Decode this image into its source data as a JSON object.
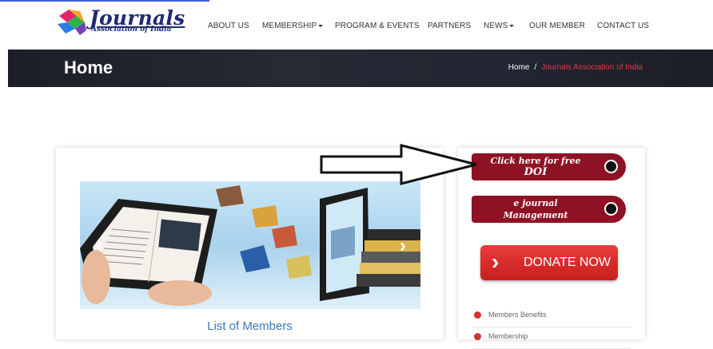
{
  "header": {
    "brand": "Journals",
    "brand_sub": "Association of India",
    "nav": [
      {
        "label": "ABOUT US",
        "dropdown": false
      },
      {
        "label": "MEMBERSHIP",
        "dropdown": true
      },
      {
        "label": "PROGRAM & EVENTS",
        "dropdown": false
      },
      {
        "label": "PARTNERS",
        "dropdown": false
      },
      {
        "label": "NEWS",
        "dropdown": true
      },
      {
        "label": "OUR MEMBER",
        "dropdown": false
      },
      {
        "label": "CONTACT US",
        "dropdown": false
      }
    ]
  },
  "banner": {
    "title": "Home",
    "breadcrumb_home": "Home",
    "breadcrumb_sep": "/",
    "breadcrumb_current": "Journals Association of India"
  },
  "main": {
    "slider_prev": "‹",
    "slider_next": "›",
    "caption": "List of Members"
  },
  "sidebar": {
    "doi_line1": "Click here for free",
    "doi_line2": "DOI",
    "ejournal_line1": "e journal",
    "ejournal_line2": "Management",
    "donate_chevron": "›",
    "donate_label": "DONATE NOW",
    "links": [
      {
        "label": "Members Benefits"
      },
      {
        "label": "Membership"
      }
    ]
  },
  "colors": {
    "pill_bg": "#8e1224",
    "donate_red": "#d52a2a",
    "brand_navy": "#1f2a73",
    "breadcrumb_current": "#e23a3a",
    "caption_blue": "#3a78b8"
  },
  "icons": [
    "logo-mark-icon",
    "caret-down-icon",
    "chevron-left-icon",
    "chevron-right-icon",
    "radio-dot-icon",
    "bullet-icon",
    "arrow-pointer-icon"
  ]
}
